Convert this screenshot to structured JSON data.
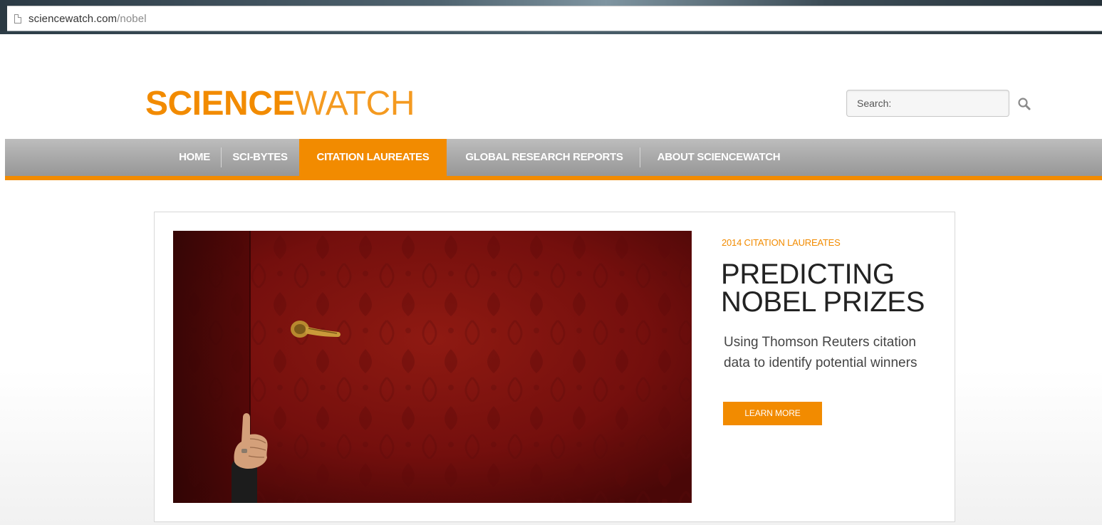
{
  "browser": {
    "url_domain": "sciencewatch.com",
    "url_path": "/nobel",
    "icons": {
      "page": "page-icon"
    }
  },
  "header": {
    "logo_bold": "SCIENCE",
    "logo_light": "WATCH",
    "search": {
      "placeholder": "Search:",
      "icon": "search-icon"
    }
  },
  "nav": {
    "items": [
      {
        "label": "HOME",
        "active": false
      },
      {
        "label": "SCI-BYTES",
        "active": false
      },
      {
        "label": "CITATION LAUREATES",
        "active": true
      },
      {
        "label": "GLOBAL RESEARCH REPORTS",
        "active": false
      },
      {
        "label": "ABOUT SCIENCEWATCH",
        "active": false
      }
    ]
  },
  "feature": {
    "eyebrow": "2014 CITATION LAUREATES",
    "headline_line1": "PREDICTING",
    "headline_line2": "NOBEL PRIZES",
    "dek": "Using Thomson Reuters citation data to identify potential winners",
    "cta": "LEARN MORE",
    "image": "red-door-thumbs-up-photo"
  },
  "colors": {
    "accent": "#f28b00",
    "nav_gray": "#a9a9a9",
    "headline": "#222222",
    "hero_red": "#6e0c0c"
  }
}
